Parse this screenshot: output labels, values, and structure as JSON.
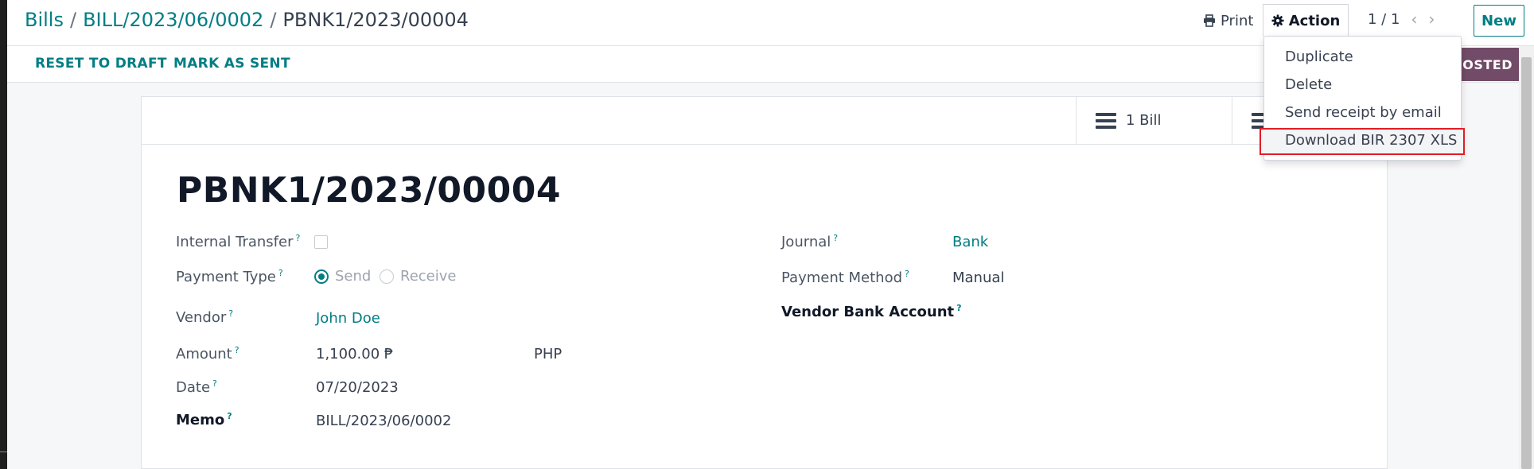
{
  "breadcrumb": {
    "items": [
      "Bills",
      "BILL/2023/06/0002"
    ],
    "separator": "/",
    "current": "PBNK1/2023/00004"
  },
  "toolbar": {
    "print_label": "Print",
    "action_label": "Action",
    "pager": "1 / 1",
    "new_label": "New"
  },
  "action_menu": {
    "items": [
      "Duplicate",
      "Delete",
      "Send receipt by email",
      "Download BIR 2307 XLS"
    ],
    "highlighted": "Download BIR 2307 XLS"
  },
  "statusbar": {
    "buttons": [
      "RESET TO DRAFT",
      "MARK AS SENT"
    ],
    "status": "POSTED"
  },
  "smart_buttons": {
    "bills_label": "1 Bill"
  },
  "record": {
    "title": "PBNK1/2023/00004",
    "help_mark": "?",
    "fields": {
      "internal_transfer": {
        "label": "Internal Transfer",
        "checked": false
      },
      "payment_type": {
        "label": "Payment Type",
        "options": [
          "Send",
          "Receive"
        ],
        "selected": "Send"
      },
      "vendor": {
        "label": "Vendor",
        "value": "John Doe"
      },
      "amount": {
        "label": "Amount",
        "value": "1,100.00 ₱",
        "currency": "PHP"
      },
      "date": {
        "label": "Date",
        "value": "07/20/2023"
      },
      "memo": {
        "label": "Memo",
        "value": "BILL/2023/06/0002"
      },
      "journal": {
        "label": "Journal",
        "value": "Bank"
      },
      "payment_method": {
        "label": "Payment Method",
        "value": "Manual"
      },
      "vendor_bank_account": {
        "label": "Vendor Bank Account",
        "value": ""
      }
    }
  },
  "colors": {
    "accent": "#017e84",
    "status": "#714b67",
    "highlight_border": "#e11d26"
  }
}
